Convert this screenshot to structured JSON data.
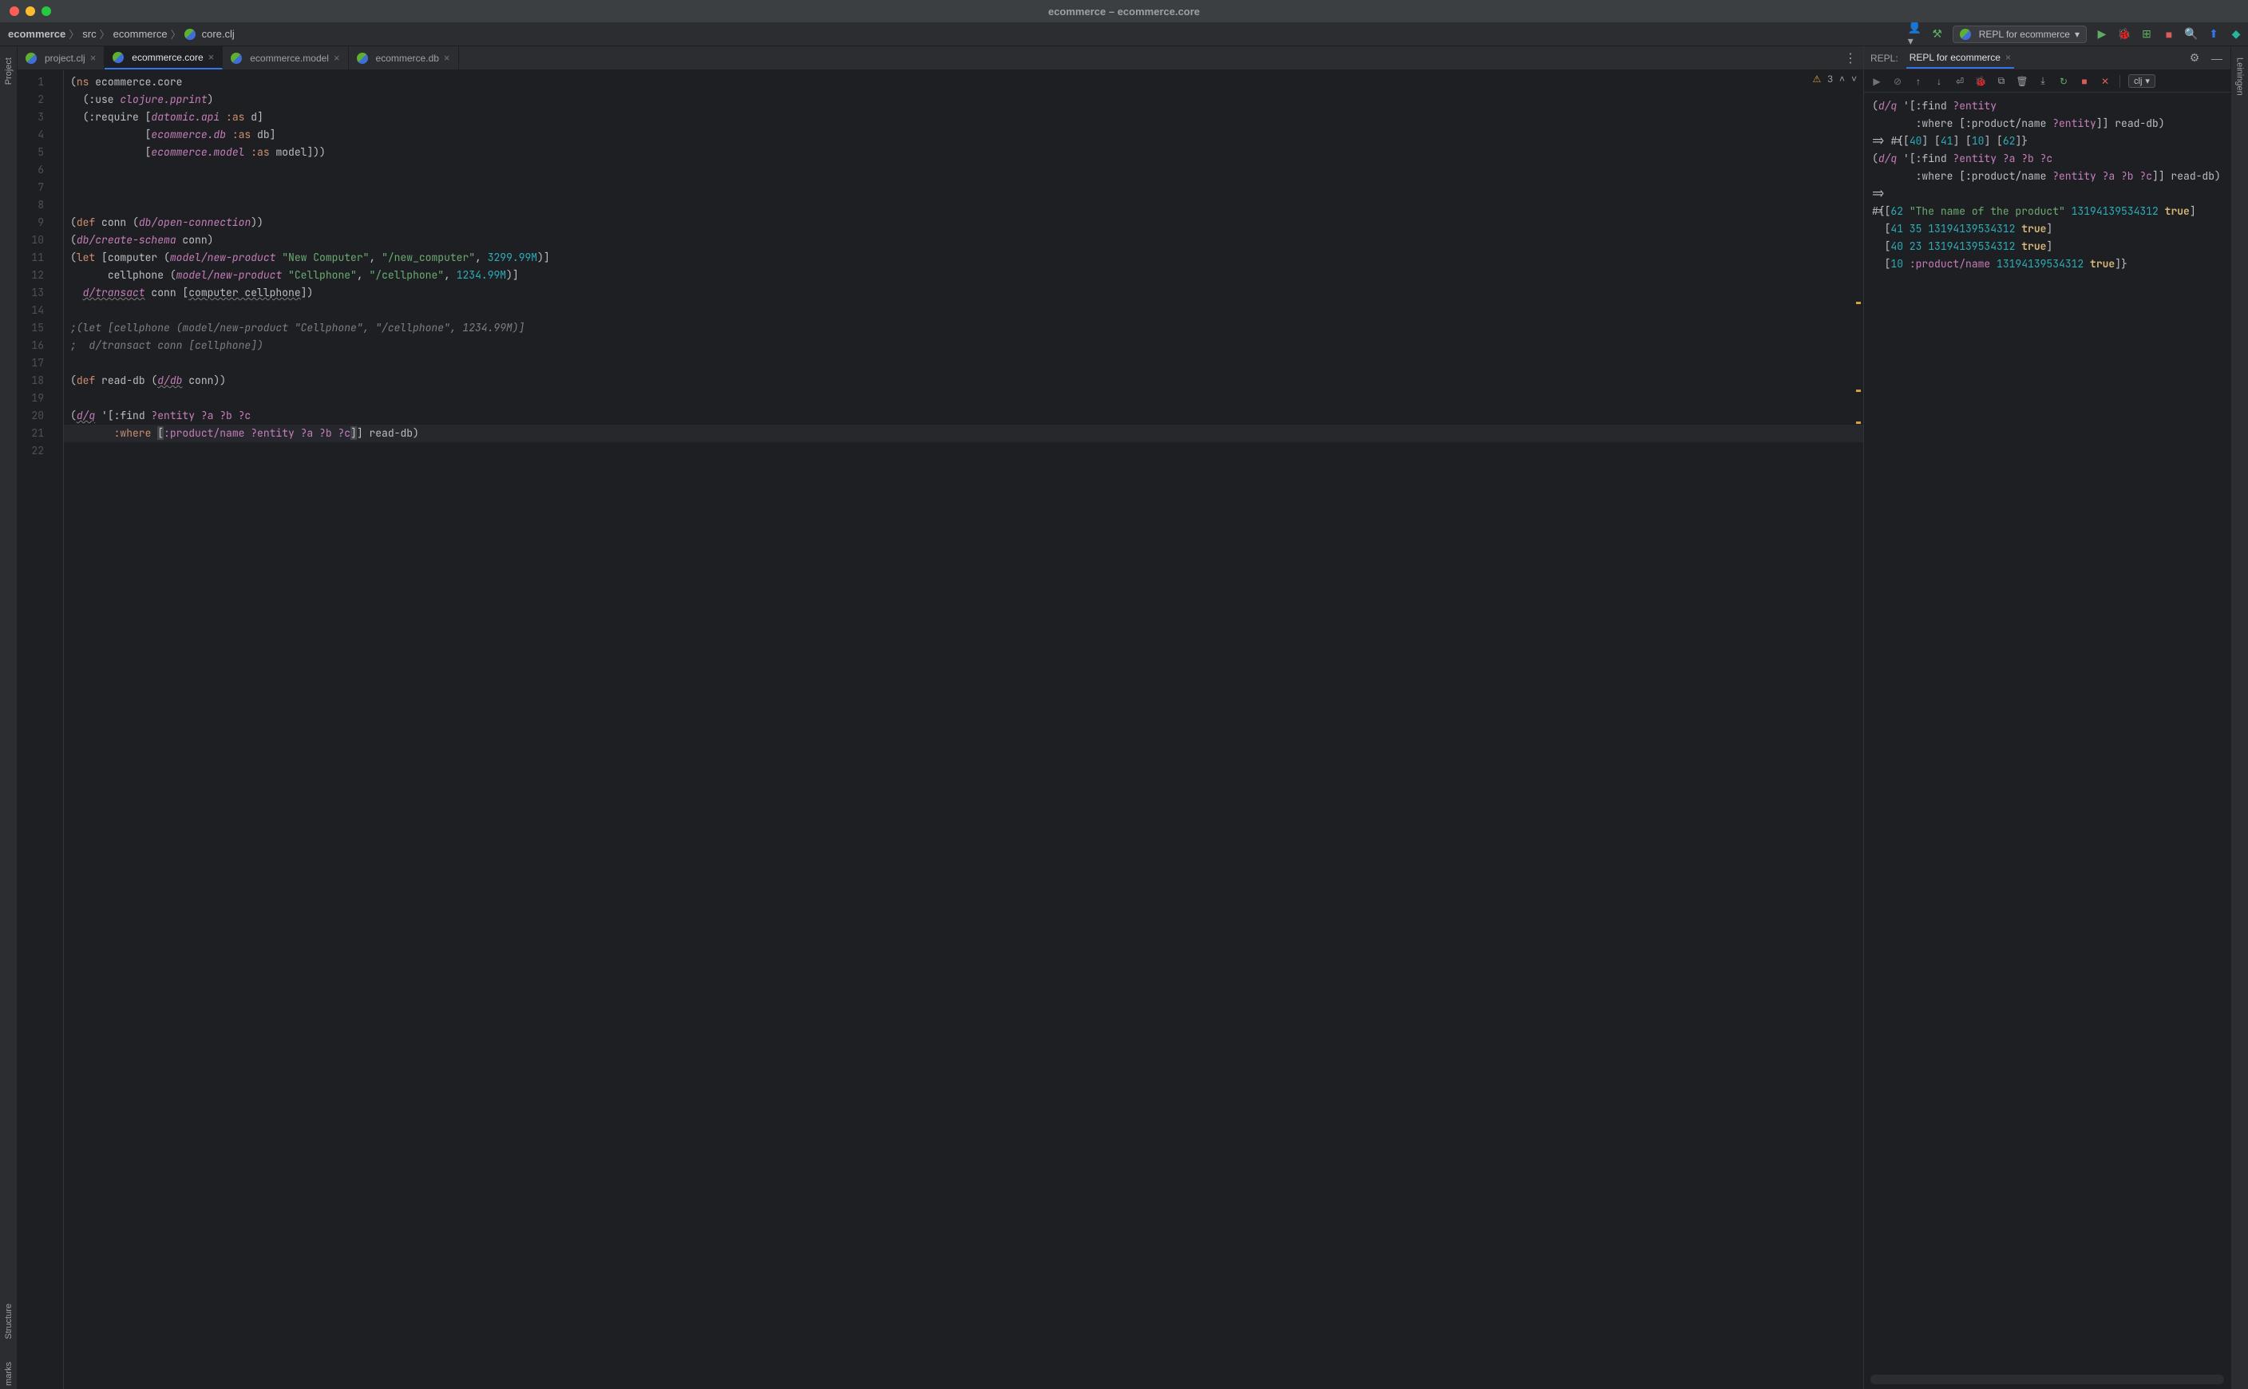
{
  "window": {
    "title": "ecommerce – ecommerce.core"
  },
  "breadcrumb": {
    "project": "ecommerce",
    "path1": "src",
    "path2": "ecommerce",
    "file": "core.clj"
  },
  "nav": {
    "repl_select": "REPL for ecommerce"
  },
  "left_rail": {
    "project": "Project"
  },
  "bottom_rail": {
    "structure": "Structure",
    "bookmarks": "marks"
  },
  "right_rail": {
    "leiningen": "Leiningen"
  },
  "tabs": [
    {
      "label": "project.clj",
      "active": false
    },
    {
      "label": "ecommerce.core",
      "active": true
    },
    {
      "label": "ecommerce.model",
      "active": false
    },
    {
      "label": "ecommerce.db",
      "active": false
    }
  ],
  "editor": {
    "warnings": "3",
    "lines": 22,
    "code_lines": [
      {
        "n": 1,
        "tokens": [
          [
            "(",
            "op"
          ],
          [
            "ns ",
            "kw"
          ],
          [
            "ecommerce.core",
            "ns"
          ]
        ],
        "indent": 0
      },
      {
        "n": 2,
        "tokens": [
          [
            "(:use ",
            "op"
          ],
          [
            "clojure.pprint",
            "fn"
          ],
          [
            ")",
            "op"
          ]
        ],
        "indent": 2
      },
      {
        "n": 3,
        "tokens": [
          [
            "(:require [",
            "op"
          ],
          [
            "datomic.api ",
            "fn"
          ],
          [
            ":as ",
            "kw"
          ],
          [
            "d",
            "sym"
          ],
          [
            "]",
            "op"
          ]
        ],
        "indent": 2
      },
      {
        "n": 4,
        "tokens": [
          [
            "[",
            "op"
          ],
          [
            "ecommerce.db ",
            "fn"
          ],
          [
            ":as ",
            "kw"
          ],
          [
            "db",
            "sym"
          ],
          [
            "]",
            "op"
          ]
        ],
        "indent": 12
      },
      {
        "n": 5,
        "tokens": [
          [
            "[",
            "op"
          ],
          [
            "ecommerce.model ",
            "fn"
          ],
          [
            ":as ",
            "kw"
          ],
          [
            "model",
            "sym"
          ],
          [
            "]))",
            "op"
          ]
        ],
        "indent": 12
      },
      {
        "n": 6,
        "tokens": [],
        "indent": 0
      },
      {
        "n": 7,
        "tokens": [],
        "indent": 0
      },
      {
        "n": 8,
        "tokens": [],
        "indent": 0
      },
      {
        "n": 9,
        "tokens": [
          [
            "(",
            "op"
          ],
          [
            "def ",
            "kw"
          ],
          [
            "conn ",
            "sym"
          ],
          [
            "(",
            "op"
          ],
          [
            "db/open-connection",
            "fn"
          ],
          [
            "))",
            "op"
          ]
        ],
        "indent": 0
      },
      {
        "n": 10,
        "tokens": [
          [
            "(",
            "op"
          ],
          [
            "db/create-schema ",
            "fn"
          ],
          [
            "conn",
            "sym"
          ],
          [
            ")",
            "op"
          ]
        ],
        "indent": 0
      },
      {
        "n": 11,
        "tokens": [
          [
            "(",
            "op"
          ],
          [
            "let ",
            "kw"
          ],
          [
            "[",
            "op"
          ],
          [
            "computer ",
            "sym"
          ],
          [
            "(",
            "op"
          ],
          [
            "model/new-product ",
            "fn"
          ],
          [
            "\"New Computer\"",
            "str"
          ],
          [
            ", ",
            "op"
          ],
          [
            "\"/new_computer\"",
            "str"
          ],
          [
            ", ",
            "op"
          ],
          [
            "3299.99M",
            "num"
          ],
          [
            ")]",
            "op"
          ]
        ],
        "indent": 0
      },
      {
        "n": 12,
        "tokens": [
          [
            "cellphone ",
            "sym"
          ],
          [
            "(",
            "op"
          ],
          [
            "model/new-product ",
            "fn"
          ],
          [
            "\"Cellphone\"",
            "str"
          ],
          [
            ", ",
            "op"
          ],
          [
            "\"/cellphone\"",
            "str"
          ],
          [
            ", ",
            "op"
          ],
          [
            "1234.99M",
            "num"
          ],
          [
            ")]",
            "op"
          ]
        ],
        "indent": 6
      },
      {
        "n": 13,
        "tokens": [
          [
            "d/transact",
            "fn ul"
          ],
          [
            " conn [",
            "op"
          ],
          [
            "computer cellphone",
            "ul"
          ],
          [
            "])",
            "op"
          ]
        ],
        "indent": 2
      },
      {
        "n": 14,
        "tokens": [],
        "indent": 0
      },
      {
        "n": 15,
        "tokens": [
          [
            ";(let [cellphone (model/new-product \"Cellphone\", \"/cellphone\", 1234.99M)]",
            "cmt"
          ]
        ],
        "indent": 0
      },
      {
        "n": 16,
        "tokens": [
          [
            ";  d/transact conn [cellphone])",
            "cmt"
          ]
        ],
        "indent": 0
      },
      {
        "n": 17,
        "tokens": [],
        "indent": 0
      },
      {
        "n": 18,
        "tokens": [
          [
            "(",
            "op"
          ],
          [
            "def ",
            "kw"
          ],
          [
            "read-db ",
            "sym"
          ],
          [
            "(",
            "op"
          ],
          [
            "d/db",
            "fn ul"
          ],
          [
            " conn))",
            "op"
          ]
        ],
        "indent": 0
      },
      {
        "n": 19,
        "tokens": [],
        "indent": 0
      },
      {
        "n": 20,
        "tokens": [
          [
            "(",
            "op"
          ],
          [
            "d/q",
            "fn ul"
          ],
          [
            " '[:find ",
            "op"
          ],
          [
            "?entity ?a ?b ?c",
            "pk"
          ]
        ],
        "indent": 0
      },
      {
        "n": 21,
        "tokens": [
          [
            ":where ",
            "kw"
          ],
          [
            "[",
            "op bracket-hl"
          ],
          [
            ":product/name ",
            "pk"
          ],
          [
            "?entity ?a ?b ?c",
            "pk"
          ],
          [
            "]",
            "op bracket-hl"
          ],
          [
            "] read-db)",
            "op"
          ]
        ],
        "indent": 7,
        "hl": true
      },
      {
        "n": 22,
        "tokens": [],
        "indent": 0
      }
    ]
  },
  "repl": {
    "header_label": "REPL:",
    "tab_label": "REPL for ecommerce",
    "lang_badge": "clj",
    "output_lines": [
      {
        "tokens": [
          [
            "(",
            "op"
          ],
          [
            "d/q",
            "fn"
          ],
          [
            " '[:find ",
            "op"
          ],
          [
            "?entity",
            "pk"
          ]
        ]
      },
      {
        "tokens": [
          [
            "       :where [:product/name ",
            "op"
          ],
          [
            "?entity",
            "pk"
          ],
          [
            "]] read-db)",
            "op"
          ]
        ]
      },
      {
        "tokens": [
          [
            "=> ",
            "op"
          ],
          [
            "#{[",
            "op"
          ],
          [
            "40",
            "num"
          ],
          [
            "] [",
            "op"
          ],
          [
            "41",
            "num"
          ],
          [
            "] [",
            "op"
          ],
          [
            "10",
            "num"
          ],
          [
            "] [",
            "op"
          ],
          [
            "62",
            "num"
          ],
          [
            "]}",
            "op"
          ]
        ]
      },
      {
        "tokens": [
          [
            "(",
            "op"
          ],
          [
            "d/q",
            "fn"
          ],
          [
            " '[:find ",
            "op"
          ],
          [
            "?entity ?a ?b ?c",
            "pk"
          ]
        ]
      },
      {
        "tokens": [
          [
            "       :where [:product/name ",
            "op"
          ],
          [
            "?entity ?a ?b ?c",
            "pk"
          ],
          [
            "]] read-db)",
            "op"
          ]
        ]
      },
      {
        "tokens": [
          [
            "=>",
            "op"
          ]
        ]
      },
      {
        "tokens": [
          [
            "#{[",
            "op"
          ],
          [
            "62 ",
            "num"
          ],
          [
            "\"The name of the product\" ",
            "str"
          ],
          [
            "13194139534312 ",
            "num"
          ],
          [
            "true",
            "bold"
          ],
          [
            "]",
            "op"
          ]
        ]
      },
      {
        "tokens": [
          [
            "  [",
            "op"
          ],
          [
            "41 35 13194139534312 ",
            "num"
          ],
          [
            "true",
            "bold"
          ],
          [
            "]",
            "op"
          ]
        ]
      },
      {
        "tokens": [
          [
            "  [",
            "op"
          ],
          [
            "40 23 13194139534312 ",
            "num"
          ],
          [
            "true",
            "bold"
          ],
          [
            "]",
            "op"
          ]
        ]
      },
      {
        "tokens": [
          [
            "  [",
            "op"
          ],
          [
            "10 ",
            "num"
          ],
          [
            ":product/name ",
            "pk"
          ],
          [
            "13194139534312 ",
            "num"
          ],
          [
            "true",
            "bold"
          ],
          [
            "]}",
            "op"
          ]
        ]
      }
    ]
  }
}
